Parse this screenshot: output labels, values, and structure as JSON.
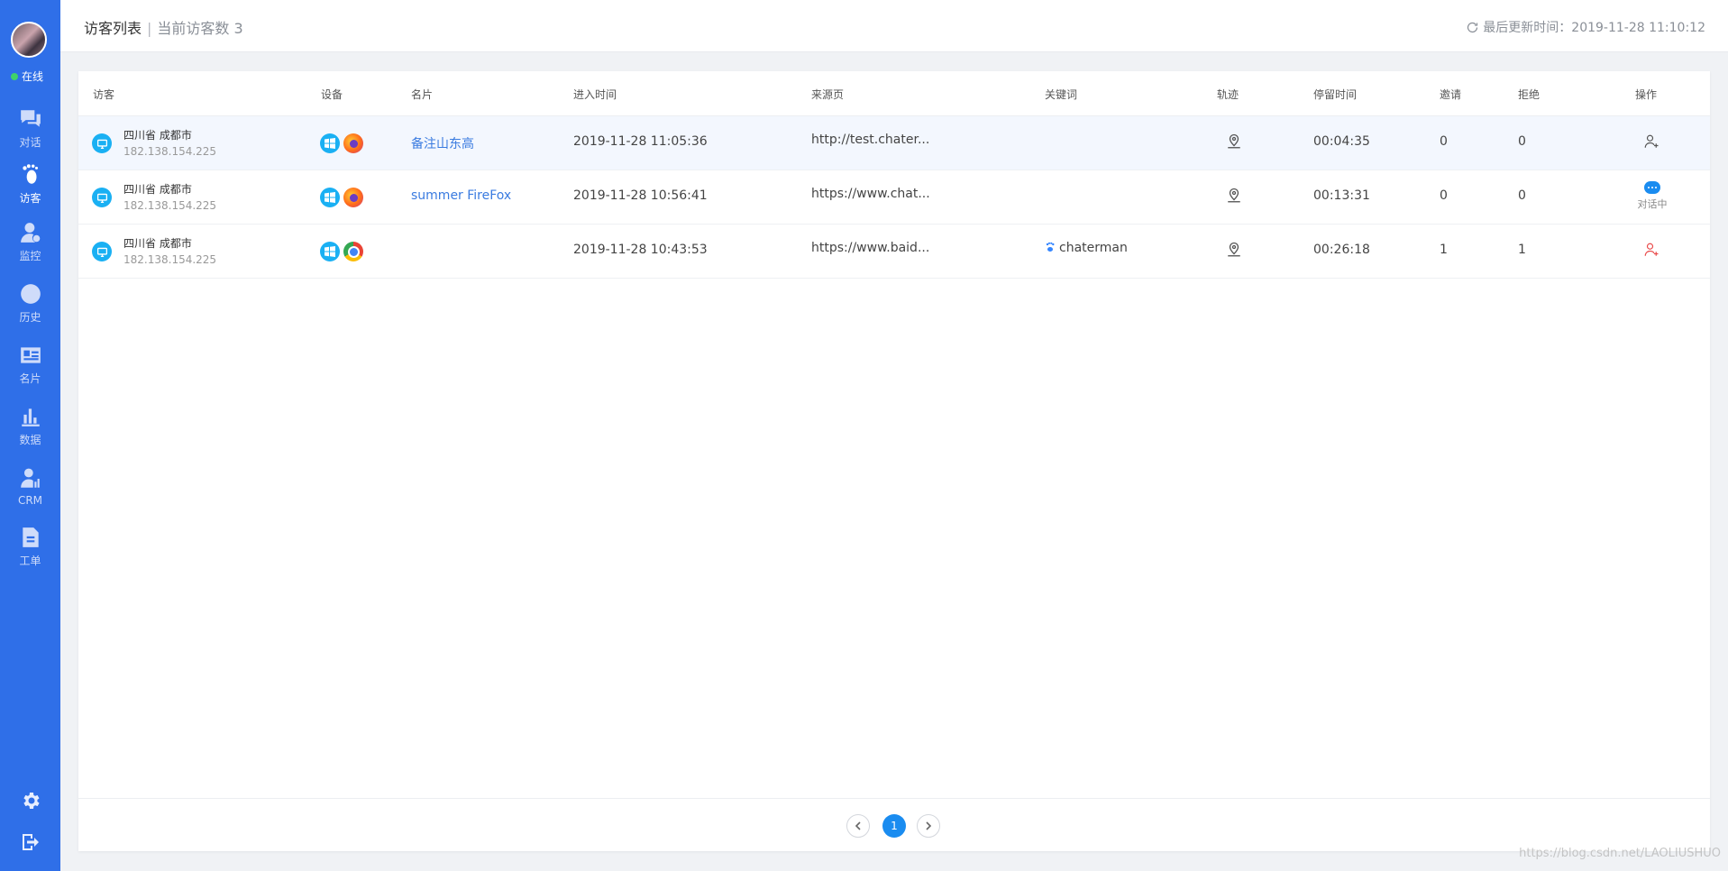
{
  "sidebar": {
    "status": "在线",
    "items": [
      {
        "label": "对话",
        "icon": "chat-icon"
      },
      {
        "label": "访客",
        "icon": "footprint-icon"
      },
      {
        "label": "监控",
        "icon": "monitor-user-icon"
      },
      {
        "label": "历史",
        "icon": "clock-icon"
      },
      {
        "label": "名片",
        "icon": "card-icon"
      },
      {
        "label": "数据",
        "icon": "bar-chart-icon"
      },
      {
        "label": "CRM",
        "icon": "crm-icon"
      },
      {
        "label": "工单",
        "icon": "ticket-icon"
      }
    ],
    "active": "访客"
  },
  "header": {
    "title": "访客列表",
    "count_text": "当前访客数 3",
    "updated_text": "最后更新时间：2019-11-28 11:10:12"
  },
  "table": {
    "columns": [
      "访客",
      "设备",
      "名片",
      "进入时间",
      "来源页",
      "关键词",
      "轨迹",
      "停留时间",
      "邀请",
      "拒绝",
      "操作"
    ],
    "rows": [
      {
        "location": "四川省 成都市",
        "ip": "182.138.154.225",
        "os": "windows",
        "browser": "firefox",
        "card": "备注山东高",
        "enter_time": "2019-11-28 11:05:36",
        "source": "http://test.chater...",
        "keyword": "",
        "stay": "00:04:35",
        "invite": "0",
        "reject": "0",
        "action": "invite"
      },
      {
        "location": "四川省 成都市",
        "ip": "182.138.154.225",
        "os": "windows",
        "browser": "firefox",
        "card": "summer FireFox",
        "enter_time": "2019-11-28 10:56:41",
        "source": "https://www.chat...",
        "keyword": "",
        "stay": "00:13:31",
        "invite": "0",
        "reject": "0",
        "action": "chatting",
        "action_label": "对话中"
      },
      {
        "location": "四川省 成都市",
        "ip": "182.138.154.225",
        "os": "windows",
        "browser": "chrome",
        "card": "",
        "enter_time": "2019-11-28 10:43:53",
        "source": "https://www.baid...",
        "keyword": "chaterman",
        "stay": "00:26:18",
        "invite": "1",
        "reject": "1",
        "action": "invite-rejected"
      }
    ]
  },
  "pagination": {
    "current": "1"
  },
  "watermark": "https://blog.csdn.net/LAOLIUSHUO",
  "colors": {
    "sidebar": "#2f6fe8",
    "accent": "#1a8cf0",
    "link": "#3a7be0",
    "danger": "#e94b4b"
  }
}
